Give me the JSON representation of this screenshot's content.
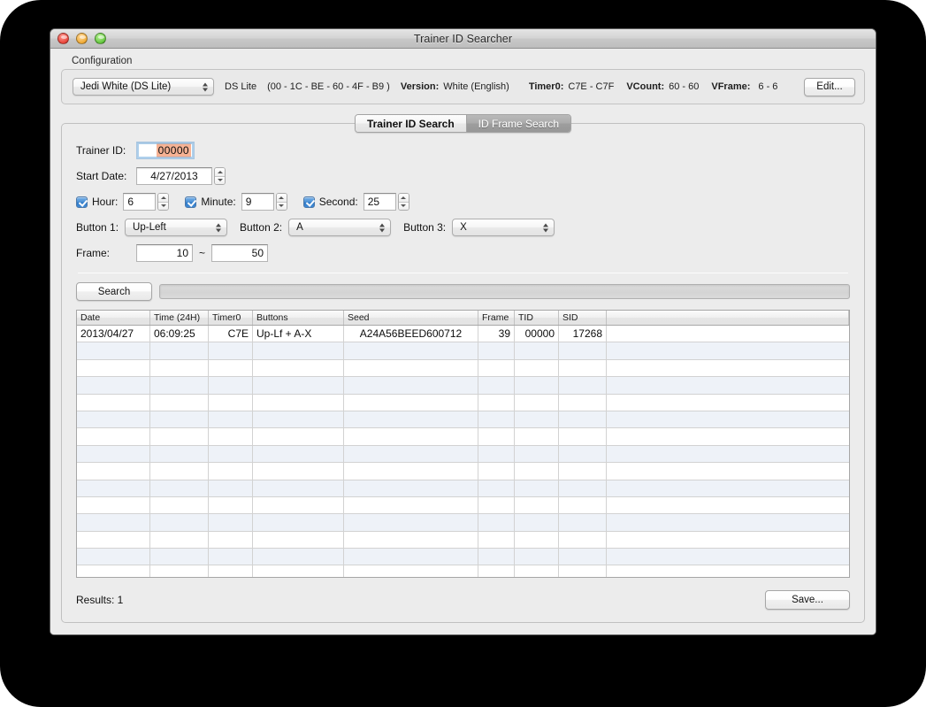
{
  "window": {
    "title": "Trainer ID Searcher",
    "traffic_lights": [
      "close",
      "minimize",
      "zoom"
    ]
  },
  "configuration": {
    "group_label": "Configuration",
    "profile_selected": "Jedi White (DS Lite)",
    "device": "DS Lite",
    "mac": "(00 - 1C - BE - 60 - 4F - B9 )",
    "version_label": "Version:",
    "version_value": "White (English)",
    "timer0_label": "Timer0:",
    "timer0_value": "C7E - C7F",
    "vcount_label": "VCount:",
    "vcount_value": "60 - 60",
    "vframe_label": "VFrame:",
    "vframe_value": "6 - 6",
    "edit_label": "Edit..."
  },
  "tabs": [
    {
      "label": "Trainer ID Search",
      "active": true
    },
    {
      "label": "ID Frame Search",
      "active": false
    }
  ],
  "form": {
    "trainer_id_label": "Trainer ID:",
    "trainer_id_value": "00000",
    "start_date_label": "Start Date:",
    "start_date_value": "4/27/2013",
    "hour_label": "Hour:",
    "hour_value": "6",
    "hour_checked": true,
    "minute_label": "Minute:",
    "minute_value": "9",
    "minute_checked": true,
    "second_label": "Second:",
    "second_value": "25",
    "second_checked": true,
    "button1_label": "Button 1:",
    "button1_value": "Up-Left",
    "button2_label": "Button 2:",
    "button2_value": "A",
    "button3_label": "Button 3:",
    "button3_value": "X",
    "frame_label": "Frame:",
    "frame_min": "10",
    "frame_tilde": "~",
    "frame_max": "50",
    "search_label": "Search",
    "progress_percent": 0
  },
  "results": {
    "columns": [
      "Date",
      "Time (24H)",
      "Timer0",
      "Buttons",
      "Seed",
      "Frame",
      "TID",
      "SID",
      ""
    ],
    "rows": [
      {
        "date": "2013/04/27",
        "time": "06:09:25",
        "timer0": "C7E",
        "buttons": "Up-Lf + A-X",
        "seed": "A24A56BEED600712",
        "frame": "39",
        "tid": "00000",
        "sid": "17268"
      }
    ],
    "empty_row_count": 14,
    "count_label": "Results: 1",
    "save_label": "Save..."
  },
  "colors": {
    "selection_highlight": "#f6b294",
    "focus_ring": "#8fbce0",
    "checkbox_blue": "#3f8ad6",
    "row_stripe": "#eef2f8",
    "window_bg": "#ececec"
  }
}
